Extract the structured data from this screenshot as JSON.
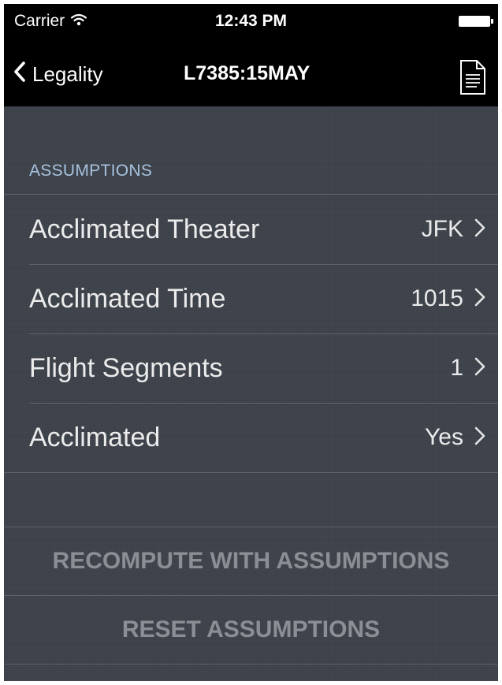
{
  "status_bar": {
    "carrier": "Carrier",
    "time": "12:43 PM",
    "wifi_icon": "wifi-icon",
    "battery_icon": "battery-icon"
  },
  "nav": {
    "back_label": "Legality",
    "back_icon": "chevron-left-icon",
    "title": "L7385:15MAY",
    "right_icon": "document-icon"
  },
  "section": {
    "header": "ASSUMPTIONS",
    "rows": [
      {
        "label": "Acclimated Theater",
        "value": "JFK"
      },
      {
        "label": "Acclimated Time",
        "value": "1015"
      },
      {
        "label": "Flight Segments",
        "value": "1"
      },
      {
        "label": "Acclimated",
        "value": "Yes"
      }
    ]
  },
  "actions": {
    "recompute_label": "RECOMPUTE WITH ASSUMPTIONS",
    "reset_label": "RESET ASSUMPTIONS"
  },
  "colors": {
    "background": "#3e434b",
    "bar": "#000000",
    "section_header": "#a7c3df",
    "row_text": "#ebebeb",
    "action_text": "#8b8f95",
    "separator": "#5d626b"
  }
}
